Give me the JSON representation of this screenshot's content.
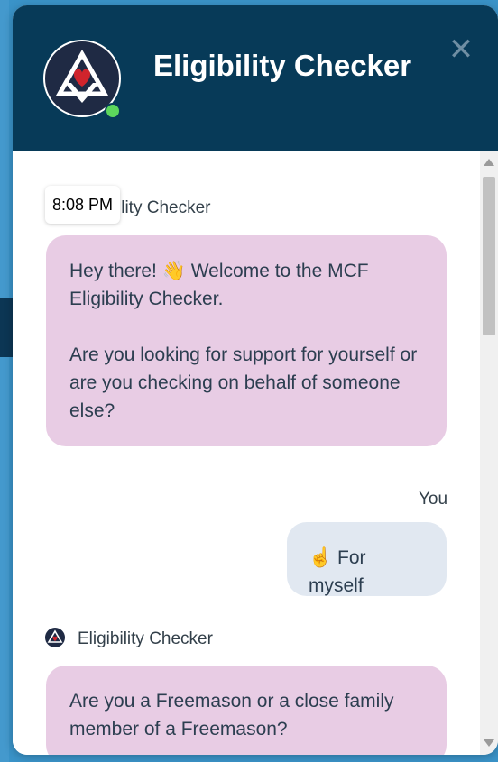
{
  "header": {
    "title": "Eligibility Checker",
    "close_icon": "close-icon",
    "online_color": "#5cd65c",
    "bg_color": "#073a58"
  },
  "messages": {
    "bot1": {
      "sender": "Eligibility Checker",
      "sender_visible": "ility Checker",
      "timestamp": "8:08 PM",
      "line1a": "Hey there!",
      "emoji1": "👋",
      "line1b": "Welcome to the MCF Eligibility Checker.",
      "line2": "Are you looking for support for yourself or are you checking on behalf of someone else?"
    },
    "user1": {
      "sender": "You",
      "emoji": "☝️",
      "text": "For myself"
    },
    "bot2": {
      "sender": "Eligibility Checker",
      "text": "Are you a Freemason or a close family member of a Freemason?"
    }
  },
  "colors": {
    "bot_bubble": "#e8cce4",
    "user_bubble": "#e1e8f1"
  }
}
